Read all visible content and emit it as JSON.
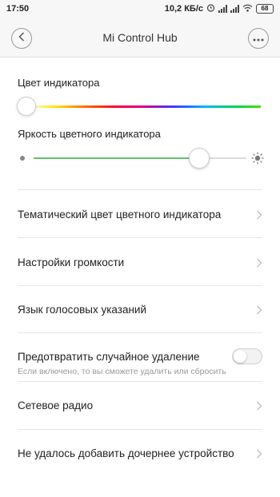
{
  "status_bar": {
    "time": "17:50",
    "speed": "10,2 КБ/с",
    "battery": "68"
  },
  "header": {
    "title": "Mi Control Hub",
    "back_icon": "chevron-left-icon",
    "more_icon": "more-dots-icon"
  },
  "indicator_color": {
    "label": "Цвет индикатора",
    "slider_value": 0.0
  },
  "brightness": {
    "label": "Яркость цветного индикатора",
    "slider_value": 0.78,
    "accent": "#5ec46a"
  },
  "menu": {
    "theme_color": "Тематический цвет цветного индикатора",
    "volume": "Настройки громкости",
    "voice_language": "Язык голосовых указаний",
    "prevent_delete": {
      "label": "Предотвратить случайное удаление",
      "description": "Если включено, то вы сможете удалить или сбросить",
      "enabled": false
    },
    "network_radio": "Сетевое радио",
    "child_device_error": "Не удалось добавить дочернее устройство"
  }
}
